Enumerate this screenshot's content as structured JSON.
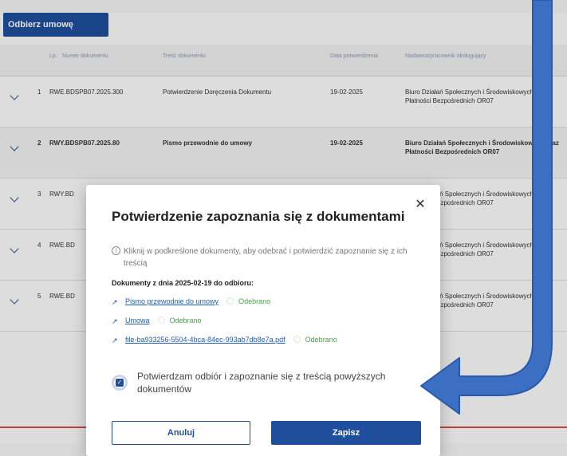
{
  "toolbar": {
    "receive_button": "Odbierz umowę"
  },
  "table": {
    "headers": [
      "Lp.",
      "Numer dokumentu",
      "Treść dokumentu",
      "Data potwierdzenia",
      "Nadawca/pracownik obsługujący"
    ],
    "rows": [
      {
        "lp": "1",
        "number": "RWE.BDSPB07.2025.300",
        "content": "Potwierdzenie Doręczenia Dokumentu",
        "date": "19-02-2025",
        "person": "Biuro Działań Społecznych i Środowiskowych oraz Płatności Bezpośrednich OR07"
      },
      {
        "lp": "2",
        "number": "RWY.BDSPB07.2025.80",
        "content": "Pismo przewodnie do umowy",
        "date": "19-02-2025",
        "person": "Biuro Działań Społecznych i Środowiskowych oraz Płatności Bezpośrednich OR07"
      },
      {
        "lp": "3",
        "number": "RWY.BD",
        "content": "",
        "date": "",
        "person": "Biuro Działań Społecznych i Środowiskowych oraz Płatności Bezpośrednich OR07"
      },
      {
        "lp": "4",
        "number": "RWE.BD",
        "content": "",
        "date": "",
        "person": "Biuro Działań Społecznych i Środowiskowych oraz Płatności Bezpośrednich OR07"
      },
      {
        "lp": "5",
        "number": "RWE.BD",
        "content": "",
        "date": "",
        "person": "Biuro Działań Społecznych i Środowiskowych oraz Płatności Bezpośrednich OR07"
      }
    ]
  },
  "modal": {
    "title": "Potwierdzenie zapoznania się z dokumentami",
    "info": "Kliknij w podkreślone dokumenty, aby odebrać i potwierdzić zapoznanie się z ich treścią",
    "documents_heading": "Dokumenty z dnia 2025-02-19 do odbioru:",
    "documents": [
      {
        "name": "Pismo przewodnie do umowy",
        "status": "Odebrano"
      },
      {
        "name": "Umowa",
        "status": "Odebrano"
      },
      {
        "name": "file-ba933256-5504-4bca-84ec-993ab7db8e7a.pdf",
        "status": "Odebrano"
      }
    ],
    "confirm_label": "Potwierdzam odbiór i zapoznanie się z treścią powyższych dokumentów",
    "confirm_checked": true,
    "cancel_button": "Anuluj",
    "save_button": "Zapisz",
    "close_icon": "close-icon"
  },
  "colors": {
    "primary": "#1f4f9c",
    "link": "#1f5fb8",
    "success": "#4aa04a",
    "annotation_arrow": "#3a6fc4",
    "danger_line": "#d94a4a"
  }
}
